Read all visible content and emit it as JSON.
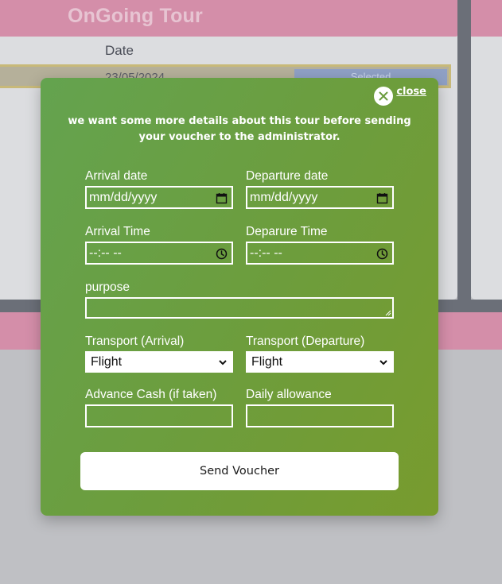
{
  "background": {
    "title": "OnGoing Tour",
    "column_header": "Date",
    "row": {
      "date": "23/05/2024",
      "status": "Selected"
    }
  },
  "modal": {
    "close_label": "close",
    "intro": "we want some more details about this tour before sending your voucher to the administrator.",
    "fields": {
      "arrival_date": {
        "label": "Arrival date",
        "placeholder": "mm/dd/yyyy"
      },
      "departure_date": {
        "label": "Departure date",
        "placeholder": "mm/dd/yyyy"
      },
      "arrival_time": {
        "label": "Arrival Time",
        "placeholder": "--:-- --"
      },
      "departure_time": {
        "label": "Deparure Time",
        "placeholder": "--:-- --"
      },
      "purpose": {
        "label": "purpose",
        "value": ""
      },
      "transport_arrival": {
        "label": "Transport (Arrival)",
        "value": "Flight"
      },
      "transport_departure": {
        "label": "Transport (Departure)",
        "value": "Flight"
      },
      "advance_cash": {
        "label": "Advance Cash (if taken)",
        "value": ""
      },
      "daily_allowance": {
        "label": "Daily allowance",
        "value": ""
      }
    },
    "submit_label": "Send Voucher"
  },
  "colors": {
    "modal_gradient_start": "#64a34f",
    "modal_gradient_end": "#789b2e",
    "page_header_pink": "#d48ea9",
    "button_background": "#ffffff"
  },
  "icons": [
    "close-icon",
    "calendar-icon",
    "clock-icon",
    "chevron-down-icon"
  ]
}
